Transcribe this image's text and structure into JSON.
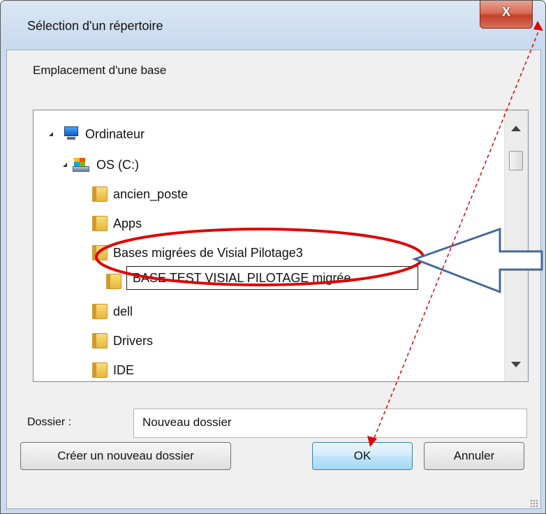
{
  "window": {
    "title": "Sélection d'un répertoire",
    "close_label": "X",
    "prompt": "Emplacement d'une base"
  },
  "tree": {
    "items": [
      {
        "label": "Ordinateur",
        "icon": "computer-icon",
        "expanded": true
      },
      {
        "label": "OS (C:)",
        "icon": "drive-icon",
        "expanded": true
      },
      {
        "label": "ancien_poste",
        "icon": "folder-icon"
      },
      {
        "label": "Apps",
        "icon": "folder-icon"
      },
      {
        "label": "Bases migrées de Visial Pilotage3",
        "icon": "folder-icon",
        "expanded": true
      },
      {
        "label": "BASE TEST VISIAL PILOTAGE migrée",
        "icon": "folder-icon",
        "editing": true
      },
      {
        "label": "dell",
        "icon": "folder-icon"
      },
      {
        "label": "Drivers",
        "icon": "folder-icon"
      },
      {
        "label": "IDE",
        "icon": "folder-icon"
      }
    ]
  },
  "folder_field": {
    "label": "Dossier :",
    "value": "Nouveau dossier"
  },
  "buttons": {
    "new_folder": "Créer un nouveau dossier",
    "ok": "OK",
    "cancel": "Annuler"
  },
  "colors": {
    "annotation_ellipse": "#e00000",
    "annotation_arrow": "#44689a",
    "annotation_dashed_arrow": "#e00000"
  }
}
